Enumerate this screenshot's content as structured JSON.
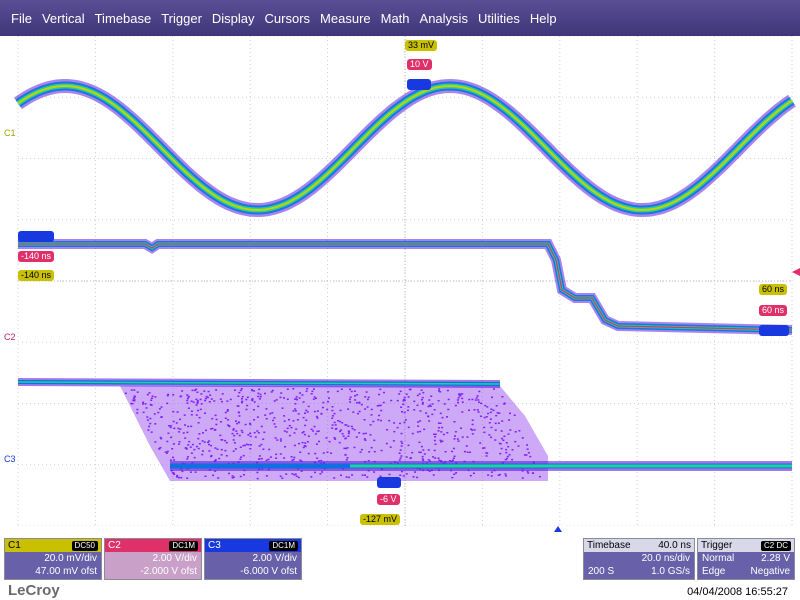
{
  "menu": [
    "File",
    "Vertical",
    "Timebase",
    "Trigger",
    "Display",
    "Cursors",
    "Measure",
    "Math",
    "Analysis",
    "Utilities",
    "Help"
  ],
  "channels": {
    "c1": {
      "label": "C1",
      "coupling": "DC50",
      "vdiv": "20.0 mV/div",
      "offset": "47.00 mV ofst",
      "color": "#c8c000"
    },
    "c2": {
      "label": "C2",
      "coupling": "DC1M",
      "vdiv": "2.00 V/div",
      "offset": "-2.000 V ofst",
      "color": "#e0306a"
    },
    "c3": {
      "label": "C3",
      "coupling": "DC1M",
      "vdiv": "2.00 V/div",
      "offset": "-6.000 V ofst",
      "color": "#1838e0"
    }
  },
  "markers": {
    "top_c1": "33 mV",
    "top_c2": "10 V",
    "top_c3": "",
    "left_c3": "",
    "left_c2": "-140 ns",
    "left_c1": "-140 ns",
    "right_c1": "60 ns",
    "right_c2": "60 ns",
    "right_c3": "",
    "bot_c3": "",
    "bot_c2": "-6 V",
    "bot_c1": "-127 mV"
  },
  "timebase": {
    "label": "Timebase",
    "delay": "40.0 ns",
    "tdiv": "20.0 ns/div",
    "samples": "200 S",
    "rate": "1.0 GS/s"
  },
  "trigger": {
    "label": "Trigger",
    "source": "C2",
    "coupling": "DC",
    "level": "2.28 V",
    "mode": "Normal",
    "type": "Edge",
    "slope": "Negative"
  },
  "brand": "LeCroy",
  "datetime": "04/04/2008 16:55:27"
}
